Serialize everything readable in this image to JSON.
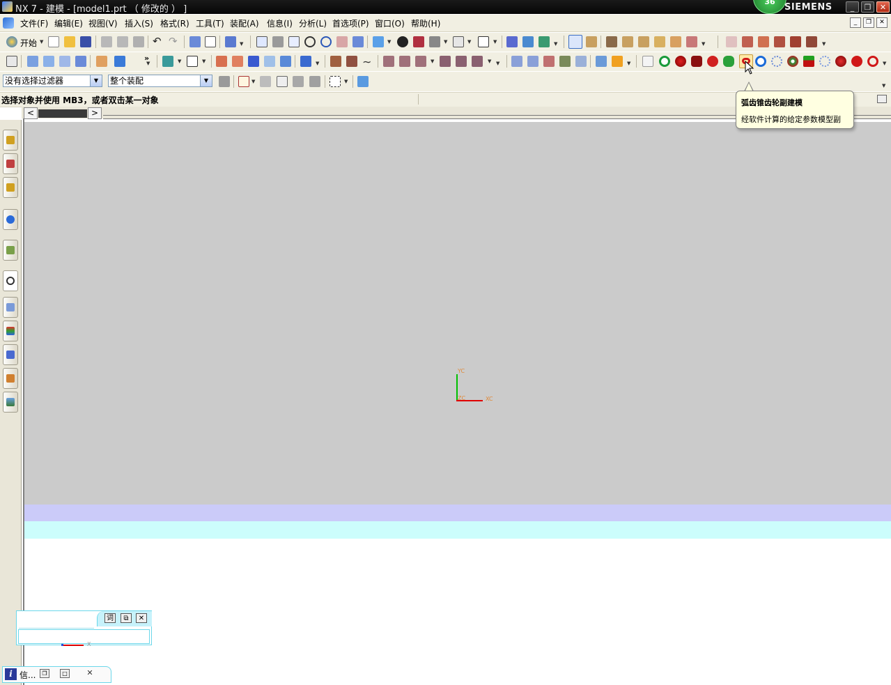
{
  "window": {
    "title": "NX 7 - 建模 - [model1.prt （ 修改的 ） ]",
    "brand": "SIEMENS",
    "badge": "36"
  },
  "menu": {
    "start": "开始",
    "items": [
      "文件(F)",
      "编辑(E)",
      "视图(V)",
      "插入(S)",
      "格式(R)",
      "工具(T)",
      "装配(A)",
      "信息(I)",
      "分析(L)",
      "首选项(P)",
      "窗口(O)",
      "帮助(H)"
    ]
  },
  "selection": {
    "filter_value": "没有选择过滤器",
    "scope_value": "整个装配"
  },
  "cue_line": "选择对象并使用 MB3，或者双击某一对象",
  "tooltip": {
    "title": "弧齿锥齿轮副建模",
    "body": "经软件计算的给定参数模型副"
  },
  "triad": {
    "yc": "YC",
    "xc": "XC",
    "zc": "ZC"
  },
  "mini_panel": {
    "buttons": [
      "词",
      "⧉",
      "✕"
    ],
    "mini_axis": "X"
  },
  "info_tab": {
    "icon": "i",
    "label": "信..."
  },
  "colors": {
    "graphics_bg": "#cbcbcb",
    "band_lavender": "#cbcbf9",
    "band_cyan": "#ccfdfc",
    "tooltip_bg": "#ffffe1",
    "axis_x": "#e00000",
    "axis_y": "#00c000"
  }
}
